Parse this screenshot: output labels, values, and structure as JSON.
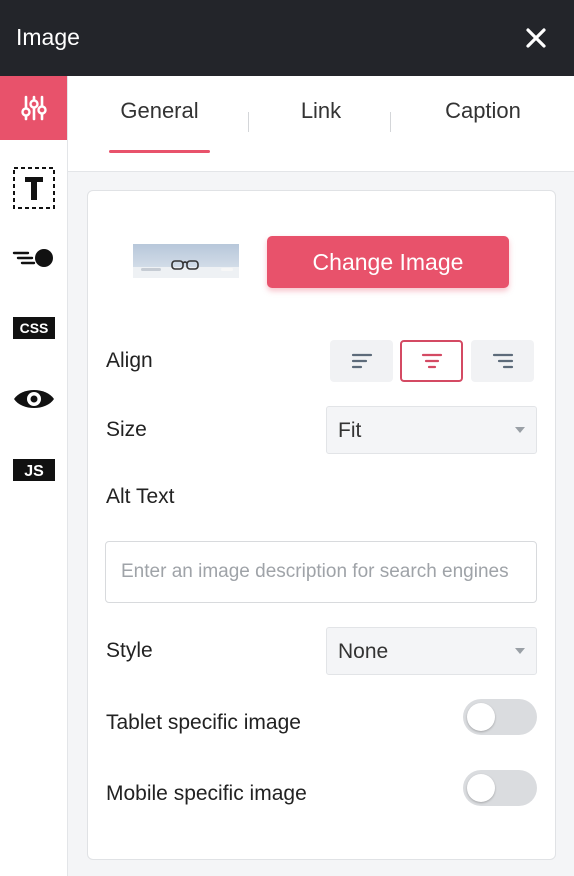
{
  "panel": {
    "title": "Image",
    "close_icon": "close-icon"
  },
  "sidebar": {
    "items": [
      {
        "name": "settings-sliders-icon",
        "active": true
      },
      {
        "name": "typography-icon",
        "active": false
      },
      {
        "name": "animation-icon",
        "active": false
      },
      {
        "name": "css-icon",
        "label": "CSS",
        "active": false
      },
      {
        "name": "visibility-eye-icon",
        "active": false
      },
      {
        "name": "js-icon",
        "label": "JS",
        "active": false
      }
    ]
  },
  "tabs": [
    {
      "label": "General",
      "active": true
    },
    {
      "label": "Link",
      "active": false
    },
    {
      "label": "Caption",
      "active": false
    }
  ],
  "image": {
    "change_label": "Change Image"
  },
  "fields": {
    "align_label": "Align",
    "align_options": [
      "left",
      "center",
      "right"
    ],
    "align_selected": "center",
    "size_label": "Size",
    "size_value": "Fit",
    "alt_label": "Alt Text",
    "alt_placeholder": "Enter an image description for search engines",
    "alt_value": "",
    "style_label": "Style",
    "style_value": "None",
    "tablet_label": "Tablet specific image",
    "tablet_on": false,
    "mobile_label": "Mobile specific image",
    "mobile_on": false
  },
  "colors": {
    "accent": "#e8526b",
    "titlebar": "#23252a"
  }
}
